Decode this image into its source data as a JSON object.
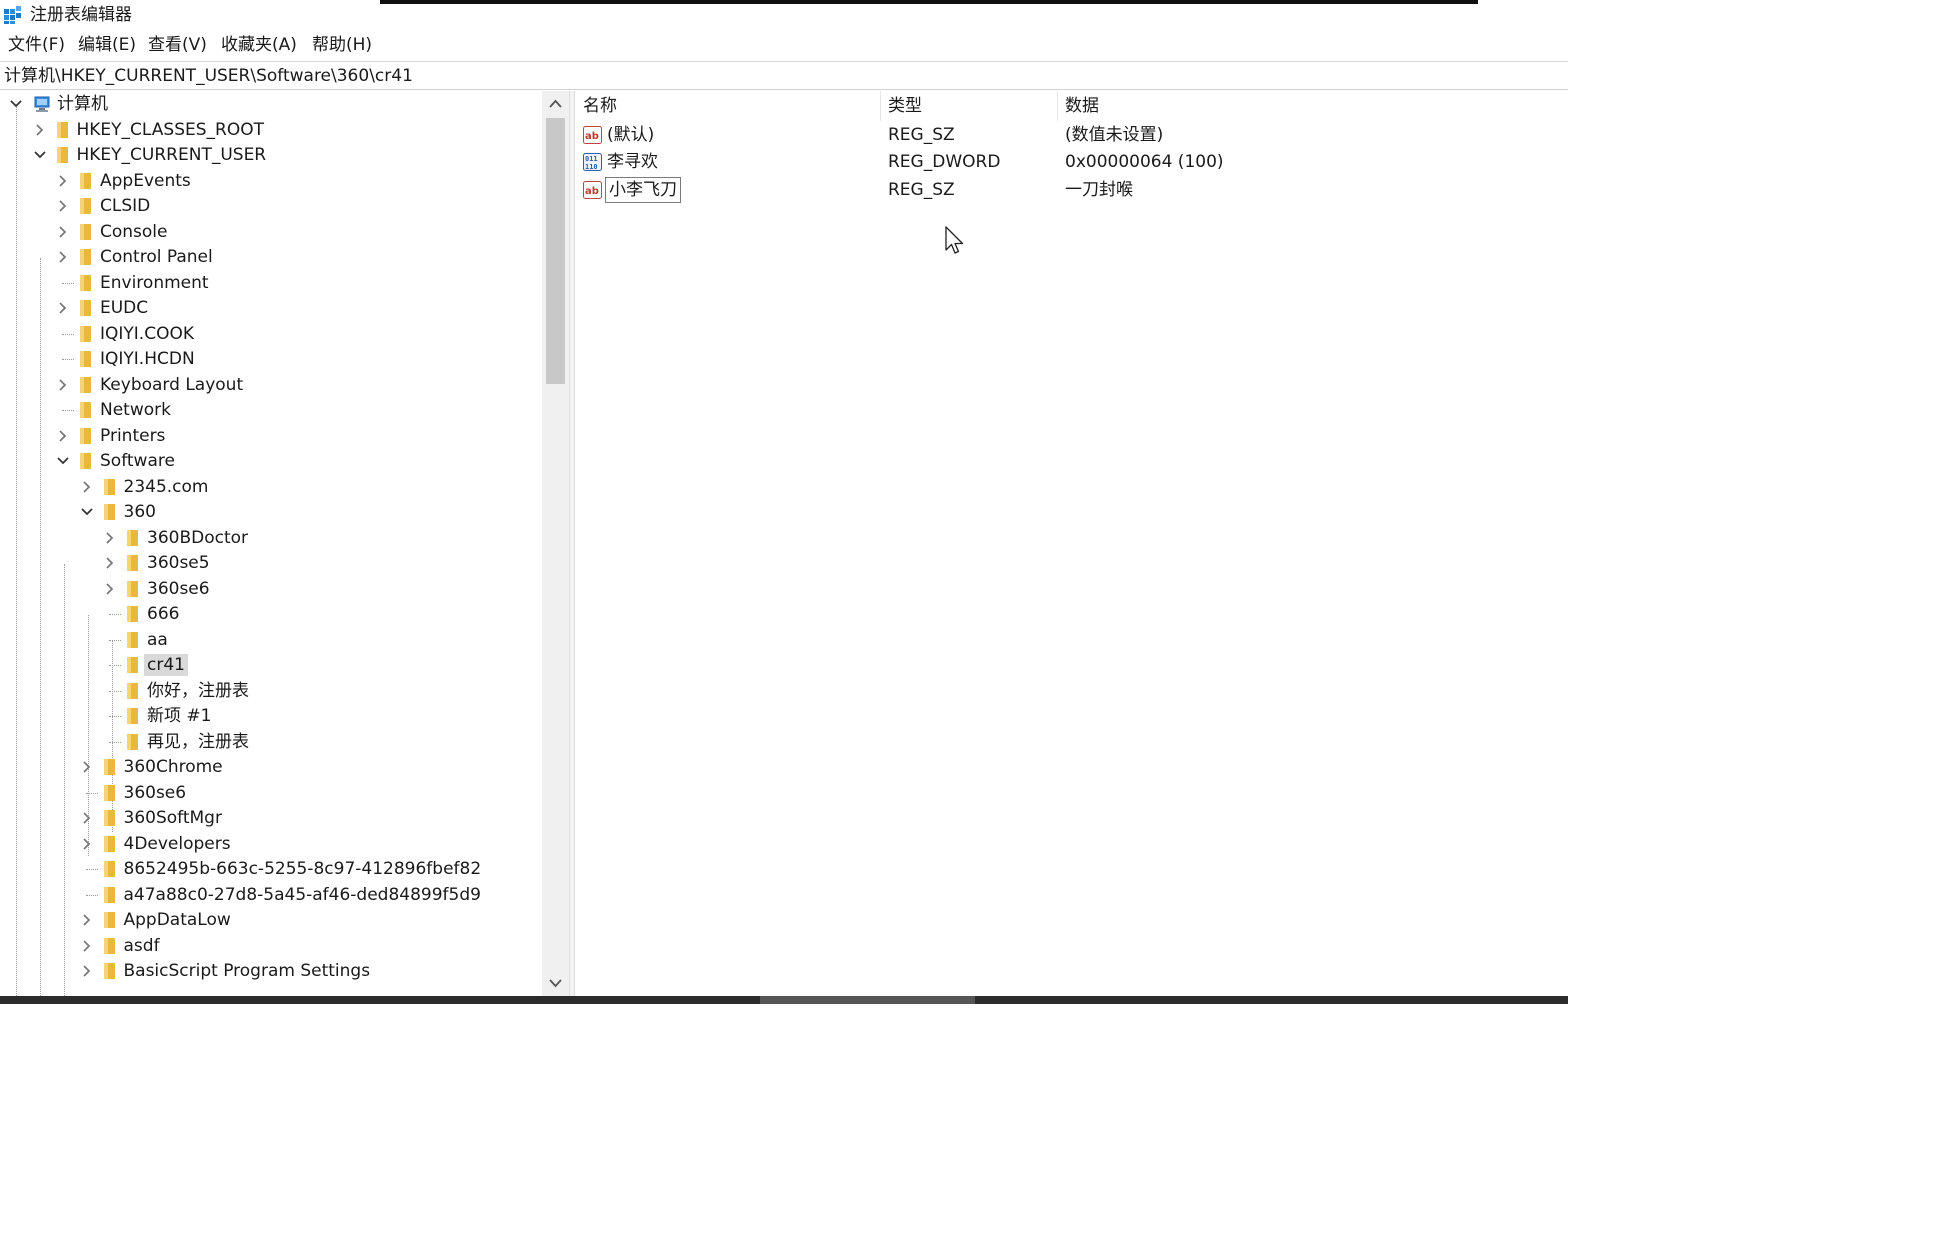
{
  "window": {
    "title": "注册表编辑器"
  },
  "menu": [
    {
      "label": "文件(F)"
    },
    {
      "label": "编辑(E)"
    },
    {
      "label": "查看(V)"
    },
    {
      "label": "收藏夹(A)"
    },
    {
      "label": "帮助(H)"
    }
  ],
  "address": {
    "path": "计算机\\HKEY_CURRENT_USER\\Software\\360\\cr41"
  },
  "tree": [
    {
      "label": "计算机",
      "expanded": true,
      "has_children": true,
      "icon": "computer-icon"
    },
    {
      "label": "HKEY_CLASSES_ROOT",
      "expanded": false,
      "has_children": true,
      "icon": "folder-icon"
    },
    {
      "label": "HKEY_CURRENT_USER",
      "expanded": true,
      "has_children": true,
      "icon": "folder-icon"
    },
    {
      "label": "AppEvents",
      "expanded": false,
      "has_children": true,
      "icon": "folder-icon"
    },
    {
      "label": "CLSID",
      "expanded": false,
      "has_children": true,
      "icon": "folder-icon"
    },
    {
      "label": "Console",
      "expanded": false,
      "has_children": true,
      "icon": "folder-icon"
    },
    {
      "label": "Control Panel",
      "expanded": false,
      "has_children": true,
      "icon": "folder-icon"
    },
    {
      "label": "Environment",
      "expanded": false,
      "has_children": false,
      "icon": "folder-icon"
    },
    {
      "label": "EUDC",
      "expanded": false,
      "has_children": true,
      "icon": "folder-icon"
    },
    {
      "label": "IQIYI.COOK",
      "expanded": false,
      "has_children": false,
      "icon": "folder-icon"
    },
    {
      "label": "IQIYI.HCDN",
      "expanded": false,
      "has_children": false,
      "icon": "folder-icon"
    },
    {
      "label": "Keyboard Layout",
      "expanded": false,
      "has_children": true,
      "icon": "folder-icon"
    },
    {
      "label": "Network",
      "expanded": false,
      "has_children": false,
      "icon": "folder-icon"
    },
    {
      "label": "Printers",
      "expanded": false,
      "has_children": true,
      "icon": "folder-icon"
    },
    {
      "label": "Software",
      "expanded": true,
      "has_children": true,
      "icon": "folder-icon"
    },
    {
      "label": "2345.com",
      "expanded": false,
      "has_children": true,
      "icon": "folder-icon"
    },
    {
      "label": "360",
      "expanded": true,
      "has_children": true,
      "icon": "folder-icon"
    },
    {
      "label": "360BDoctor",
      "expanded": false,
      "has_children": true,
      "icon": "folder-icon"
    },
    {
      "label": "360se5",
      "expanded": false,
      "has_children": true,
      "icon": "folder-icon"
    },
    {
      "label": "360se6",
      "expanded": false,
      "has_children": true,
      "icon": "folder-icon"
    },
    {
      "label": "666",
      "expanded": false,
      "has_children": false,
      "icon": "folder-icon"
    },
    {
      "label": "aa",
      "expanded": false,
      "has_children": false,
      "icon": "folder-icon"
    },
    {
      "label": "cr41",
      "expanded": false,
      "has_children": false,
      "icon": "folder-icon",
      "selected": true
    },
    {
      "label": "你好，注册表",
      "expanded": false,
      "has_children": false,
      "icon": "folder-icon"
    },
    {
      "label": "新项 #1",
      "expanded": false,
      "has_children": false,
      "icon": "folder-icon"
    },
    {
      "label": "再见，注册表",
      "expanded": false,
      "has_children": false,
      "icon": "folder-icon"
    },
    {
      "label": "360Chrome",
      "expanded": false,
      "has_children": true,
      "icon": "folder-icon"
    },
    {
      "label": "360se6",
      "expanded": false,
      "has_children": false,
      "icon": "folder-icon"
    },
    {
      "label": "360SoftMgr",
      "expanded": false,
      "has_children": true,
      "icon": "folder-icon"
    },
    {
      "label": "4Developers",
      "expanded": false,
      "has_children": true,
      "icon": "folder-icon"
    },
    {
      "label": "8652495b-663c-5255-8c97-412896fbef82",
      "expanded": false,
      "has_children": false,
      "icon": "folder-icon"
    },
    {
      "label": "a47a88c0-27d8-5a45-af46-ded84899f5d9",
      "expanded": false,
      "has_children": false,
      "icon": "folder-icon"
    },
    {
      "label": "AppDataLow",
      "expanded": false,
      "has_children": true,
      "icon": "folder-icon"
    },
    {
      "label": "asdf",
      "expanded": false,
      "has_children": true,
      "icon": "folder-icon"
    },
    {
      "label": "BasicScript Program Settings",
      "expanded": false,
      "has_children": true,
      "icon": "folder-icon"
    }
  ],
  "columns": {
    "name": "名称",
    "type": "类型",
    "data": "数据"
  },
  "values": [
    {
      "name": "(默认)",
      "type": "REG_SZ",
      "data": "(数值未设置)",
      "icon": "string-value-icon"
    },
    {
      "name": "李寻欢",
      "type": "REG_DWORD",
      "data": "0x00000064 (100)",
      "icon": "binary-value-icon"
    },
    {
      "name": "小李飞刀",
      "type": "REG_SZ",
      "data": "一刀封喉",
      "icon": "string-value-icon",
      "editing": true
    }
  ],
  "colors": {
    "folder": "#e8b93a",
    "selection": "#d9d9d9",
    "accent": "#0b6fc6"
  }
}
